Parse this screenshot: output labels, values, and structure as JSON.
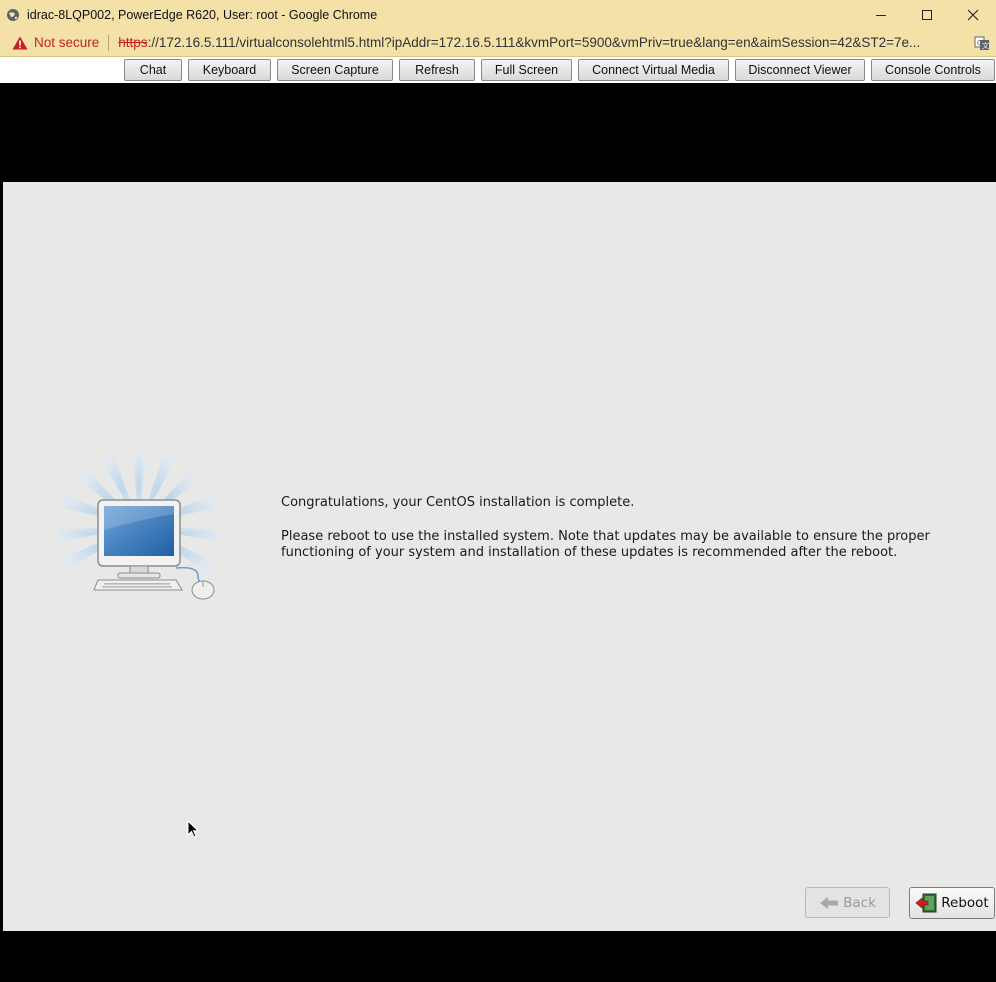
{
  "window": {
    "title": "idrac-8LQP002, PowerEdge R620, User: root - Google Chrome",
    "controls": {
      "minimize_icon": "minimize-icon",
      "maximize_icon": "maximize-icon",
      "close_icon": "close-icon"
    }
  },
  "address_bar": {
    "security_label": "Not secure",
    "url_protocol": "https",
    "url_rest": "://172.16.5.111/virtualconsolehtml5.html?ipAddr=172.16.5.111&kvmPort=5900&vmPriv=true&lang=en&aimSession=42&ST2=7e..."
  },
  "toolbar": {
    "buttons": [
      {
        "label": "Chat"
      },
      {
        "label": "Keyboard"
      },
      {
        "label": "Screen Capture"
      },
      {
        "label": "Refresh"
      },
      {
        "label": "Full Screen"
      },
      {
        "label": "Connect Virtual Media"
      },
      {
        "label": "Disconnect Viewer"
      },
      {
        "label": "Console Controls"
      }
    ]
  },
  "installer": {
    "message_line1": "Congratulations, your CentOS installation is complete.",
    "message_line2": "Please reboot to use the installed system.  Note that updates may be available to ensure the proper",
    "message_line3": "functioning of your system and installation of these updates is recommended after the reboot.",
    "back_label": "Back",
    "reboot_label": "Reboot",
    "back_enabled": false
  },
  "colors": {
    "chrome_bar": "#f3e1a8",
    "not_secure": "#c5221f",
    "installer_bg": "#e8e8e7",
    "console_bg": "#000000"
  }
}
